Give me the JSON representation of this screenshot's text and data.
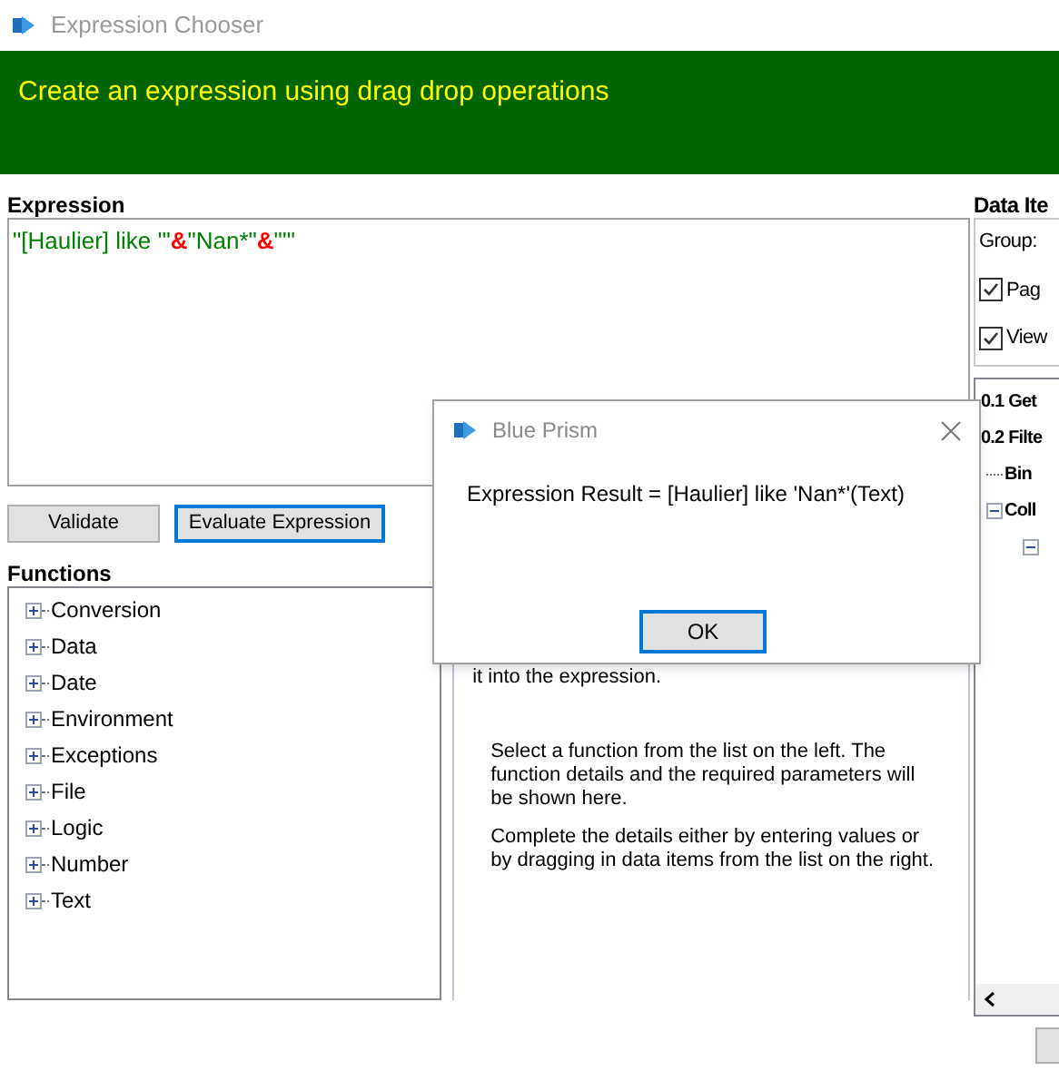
{
  "window": {
    "title": "Expression Chooser"
  },
  "banner": "Create an expression using drag drop operations",
  "expression": {
    "label": "Expression",
    "segments": [
      {
        "kind": "string",
        "text": "\"[Haulier] like '\""
      },
      {
        "kind": "operator",
        "text": "&"
      },
      {
        "kind": "string",
        "text": "\"Nan*\""
      },
      {
        "kind": "operator",
        "text": "&"
      },
      {
        "kind": "string",
        "text": "\"'\""
      }
    ]
  },
  "buttons": [
    {
      "label": "Validate",
      "focused": false
    },
    {
      "label": "Evaluate Expression",
      "focused": true
    }
  ],
  "functions": {
    "label": "Functions",
    "items": [
      "Conversion",
      "Data",
      "Date",
      "Environment",
      "Exceptions",
      "File",
      "Logic",
      "Number",
      "Text"
    ]
  },
  "details": {
    "paragraphs": [
      "it into the expression.",
      "Select a function from the list on the left. The function details and the required parameters will be shown here.",
      "Complete the details either by entering values or by dragging in data items from the list on the right."
    ]
  },
  "data_items": {
    "label": "Data Ite",
    "group_label": "Group:",
    "checkboxes": [
      {
        "label": "Pag",
        "checked": true
      },
      {
        "label": "View",
        "checked": true
      }
    ],
    "tree": [
      {
        "label": "0.1 Get"
      },
      {
        "label": "0.2 Filte",
        "children": [
          {
            "label": "Bin"
          },
          {
            "label": "Coll",
            "expanded": true
          }
        ]
      }
    ]
  },
  "dialog": {
    "title": "Blue Prism",
    "message": "Expression Result = [Haulier] like 'Nan*'(Text)",
    "button": "OK"
  }
}
